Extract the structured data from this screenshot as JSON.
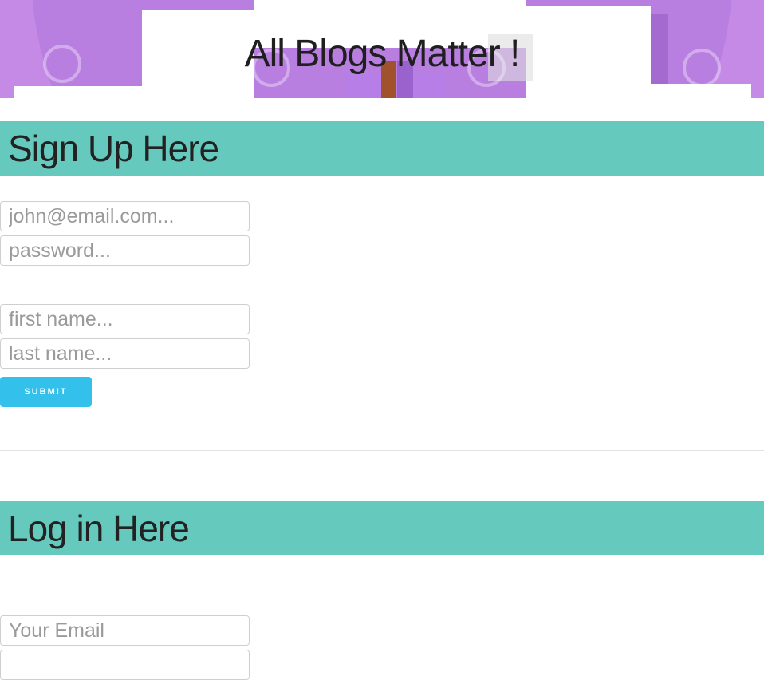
{
  "banner": {
    "title": "All Blogs Matter !"
  },
  "signup": {
    "heading": "Sign Up Here",
    "email_placeholder": "john@email.com...",
    "password_placeholder": "password...",
    "first_name_placeholder": "first name...",
    "last_name_placeholder": "last name...",
    "submit_label": "SUBMIT"
  },
  "login": {
    "heading": "Log in Here",
    "email_placeholder": "Your Email"
  },
  "colors": {
    "section_header": "#66c9bd",
    "submit_button": "#33c1ec",
    "banner_purple": "#c58ae6"
  }
}
